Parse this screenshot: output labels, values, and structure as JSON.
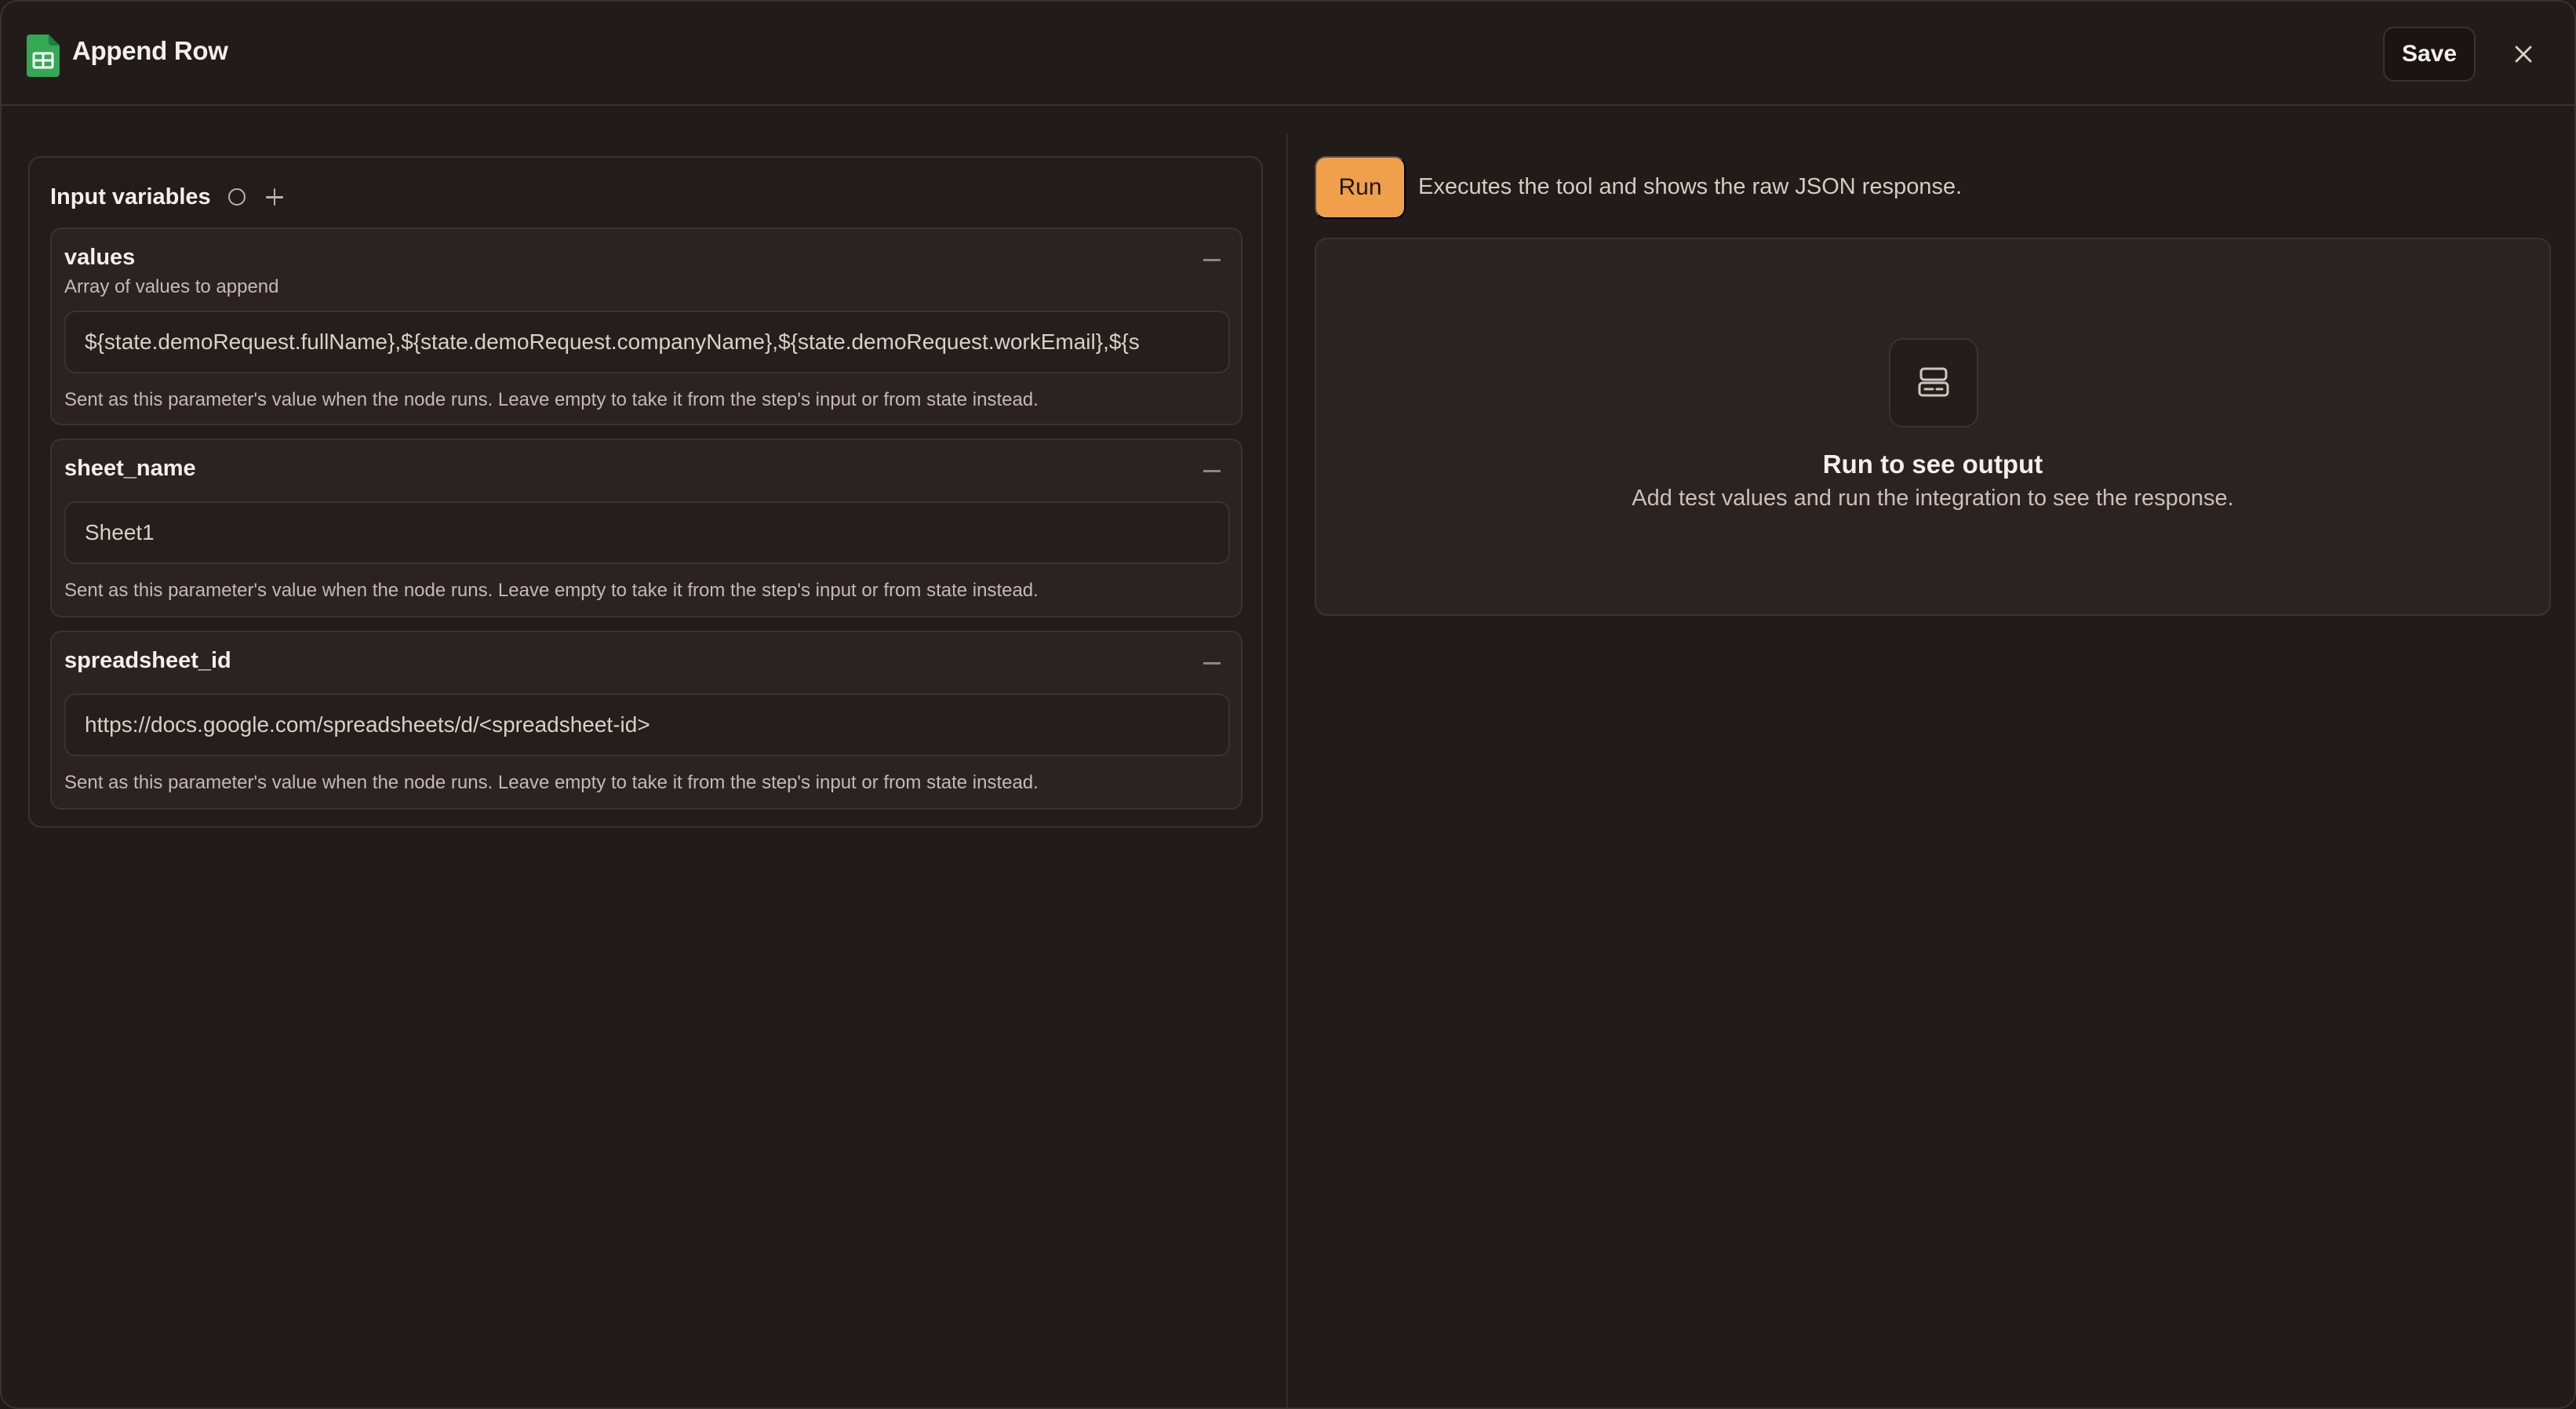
{
  "header": {
    "title": "Append Row",
    "app_icon": "google-sheets-icon",
    "save_label": "Save",
    "close_icon": "close-icon"
  },
  "input_variables": {
    "title": "Input variables",
    "items": [
      {
        "name": "values",
        "description": "Array of values to append",
        "value": "${state.demoRequest.fullName},${state.demoRequest.companyName},${state.demoRequest.workEmail},${s",
        "help": "Sent as this parameter's value when the node runs. Leave empty to take it from the step's input or from state instead."
      },
      {
        "name": "sheet_name",
        "description": "",
        "value": "Sheet1",
        "help": "Sent as this parameter's value when the node runs. Leave empty to take it from the step's input or from state instead."
      },
      {
        "name": "spreadsheet_id",
        "description": "",
        "value": "https://docs.google.com/spreadsheets/d/<spreadsheet-id>",
        "help": "Sent as this parameter's value when the node runs. Leave empty to take it from the step's input or from state instead."
      }
    ]
  },
  "run": {
    "label": "Run",
    "description": "Executes the tool and shows the raw JSON response."
  },
  "output": {
    "title": "Run to see output",
    "subtitle": "Add test values and run the integration to see the response."
  },
  "colors": {
    "accent": "#f0a04b",
    "background": "#211b19",
    "sheets_green": "#2f9e5a"
  }
}
